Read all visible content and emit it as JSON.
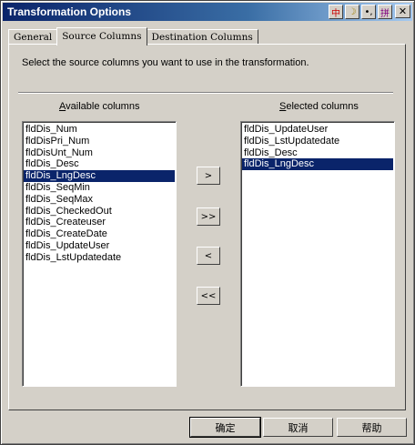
{
  "window": {
    "title": "Transformation Options",
    "close_glyph": "✕",
    "ime": [
      "中",
      "☽",
      "•,",
      "拼"
    ]
  },
  "tabs": [
    {
      "label": "General"
    },
    {
      "label": "Source Columns",
      "active": true
    },
    {
      "label": "Destination Columns"
    }
  ],
  "panel": {
    "instructions": "Select the source columns you want to use in the transformation.",
    "available_label": "Available columns",
    "selected_label": "Selected columns",
    "available": [
      "fldDis_Num",
      "fldDisPri_Num",
      "fldDisUnt_Num",
      "fldDis_Desc",
      "fldDis_LngDesc",
      "fldDis_SeqMin",
      "fldDis_SeqMax",
      "fldDis_CheckedOut",
      "fldDis_Createuser",
      "fldDis_CreateDate",
      "fldDis_UpdateUser",
      "fldDis_LstUpdatedate"
    ],
    "available_selected_index": 4,
    "selected": [
      "fldDis_UpdateUser",
      "fldDis_LstUpdatedate",
      "fldDis_Desc",
      "fldDis_LngDesc"
    ],
    "selected_selected_index": 3,
    "buttons": {
      "add": ">",
      "add_all": ">>",
      "remove": "<",
      "remove_all": "<<"
    }
  },
  "footer": {
    "ok": "确定",
    "cancel": "取消",
    "help": "帮助"
  }
}
